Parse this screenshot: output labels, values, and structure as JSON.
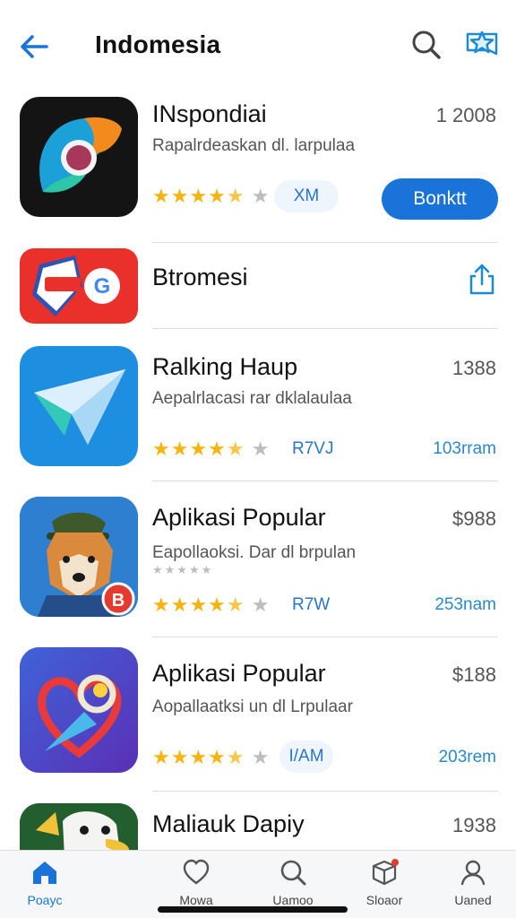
{
  "header": {
    "title": "Indomesia",
    "back_icon": "arrow-left-icon",
    "search_icon": "search-icon",
    "fav_icon": "star-badge-icon",
    "accent": "#1a73d9"
  },
  "apps": [
    {
      "name": "INspondiai",
      "count": "1 2008",
      "subtitle": "Rapalrdeaskan dl. larpulaa",
      "rating": 4.5,
      "size": "XM",
      "action": "Bonktt"
    },
    {
      "name": "Btromesi"
    },
    {
      "name": "Ralking Haup",
      "count": "1388",
      "subtitle": "Aepalrlacasi  rar dklalaulaa",
      "rating": 4.5,
      "size": "R7VJ",
      "downloads": "103rram"
    },
    {
      "name": "Aplikasi Popular",
      "count": "$988",
      "subtitle": "Eapollaoksi. Dar dl brpulan",
      "faint": "★★★★★",
      "rating": 4.5,
      "size": "R7W",
      "downloads": "253nam"
    },
    {
      "name": "Aplikasi Popular",
      "count": "$188",
      "subtitle": "Aopallaatksi  un dl Lrpulaar",
      "rating": 4.5,
      "size": "I/AM",
      "downloads": "203rem"
    },
    {
      "name": "Maliauk Dapiy",
      "count": "1938"
    }
  ],
  "tabbar": [
    {
      "label": "Poayc",
      "icon": "home-icon",
      "active": true
    },
    {
      "label": "Mowa",
      "icon": "heart-icon",
      "active": false
    },
    {
      "label": "Uamoo",
      "icon": "search-icon",
      "active": false
    },
    {
      "label": "Sloaor",
      "icon": "cube-icon",
      "active": false
    },
    {
      "label": "Uaned",
      "icon": "person-icon",
      "active": false
    }
  ]
}
